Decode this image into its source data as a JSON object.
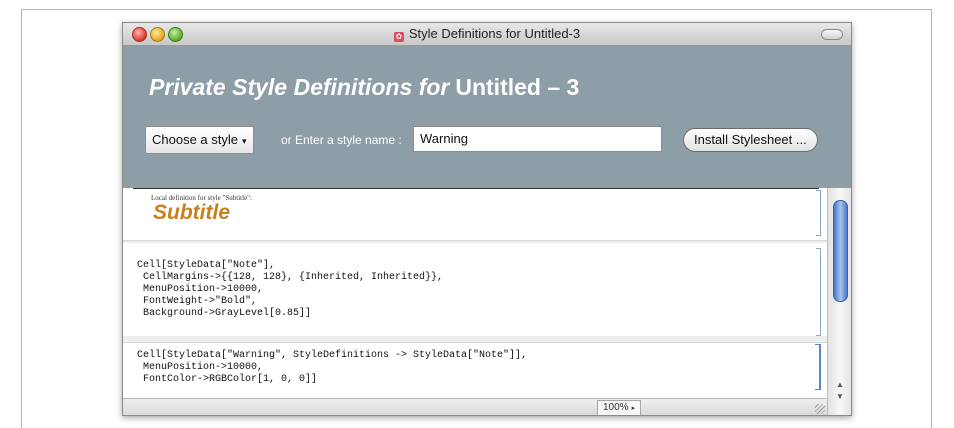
{
  "window": {
    "title": "Style Definitions for Untitled-3"
  },
  "header": {
    "heading_italic": "Private Style Definitions for",
    "heading_doc": "Untitled – 3",
    "choose_style_label": "Choose a style",
    "choose_style_arrow": "▾",
    "or_label": "or  Enter a style name :",
    "style_name_value": "Warning",
    "install_button_label": "Install Stylesheet ..."
  },
  "cells": {
    "local_definition_label": "Local definition for style \"Subtitle\":",
    "subtitle_preview": "Subtitle",
    "note_code": "Cell[StyleData[\"Note\"],\n CellMargins->{{128, 128}, {Inherited, Inherited}},\n MenuPosition->10000,\n FontWeight->\"Bold\",\n Background->GrayLevel[0.85]]",
    "warning_code": "Cell[StyleData[\"Warning\", StyleDefinitions -> StyleData[\"Note\"]],\n MenuPosition->10000,\n FontColor->RGBColor[1, 0, 0]]"
  },
  "statusbar": {
    "zoom": "100%",
    "zoom_arrow": "▸"
  },
  "scrollbar": {
    "up_arrow": "▲",
    "down_arrow": "▼"
  },
  "colors": {
    "header_bg": "#8e9ea7",
    "subtitle_color": "#c8801c",
    "scroll_thumb": "#4a78c8"
  }
}
